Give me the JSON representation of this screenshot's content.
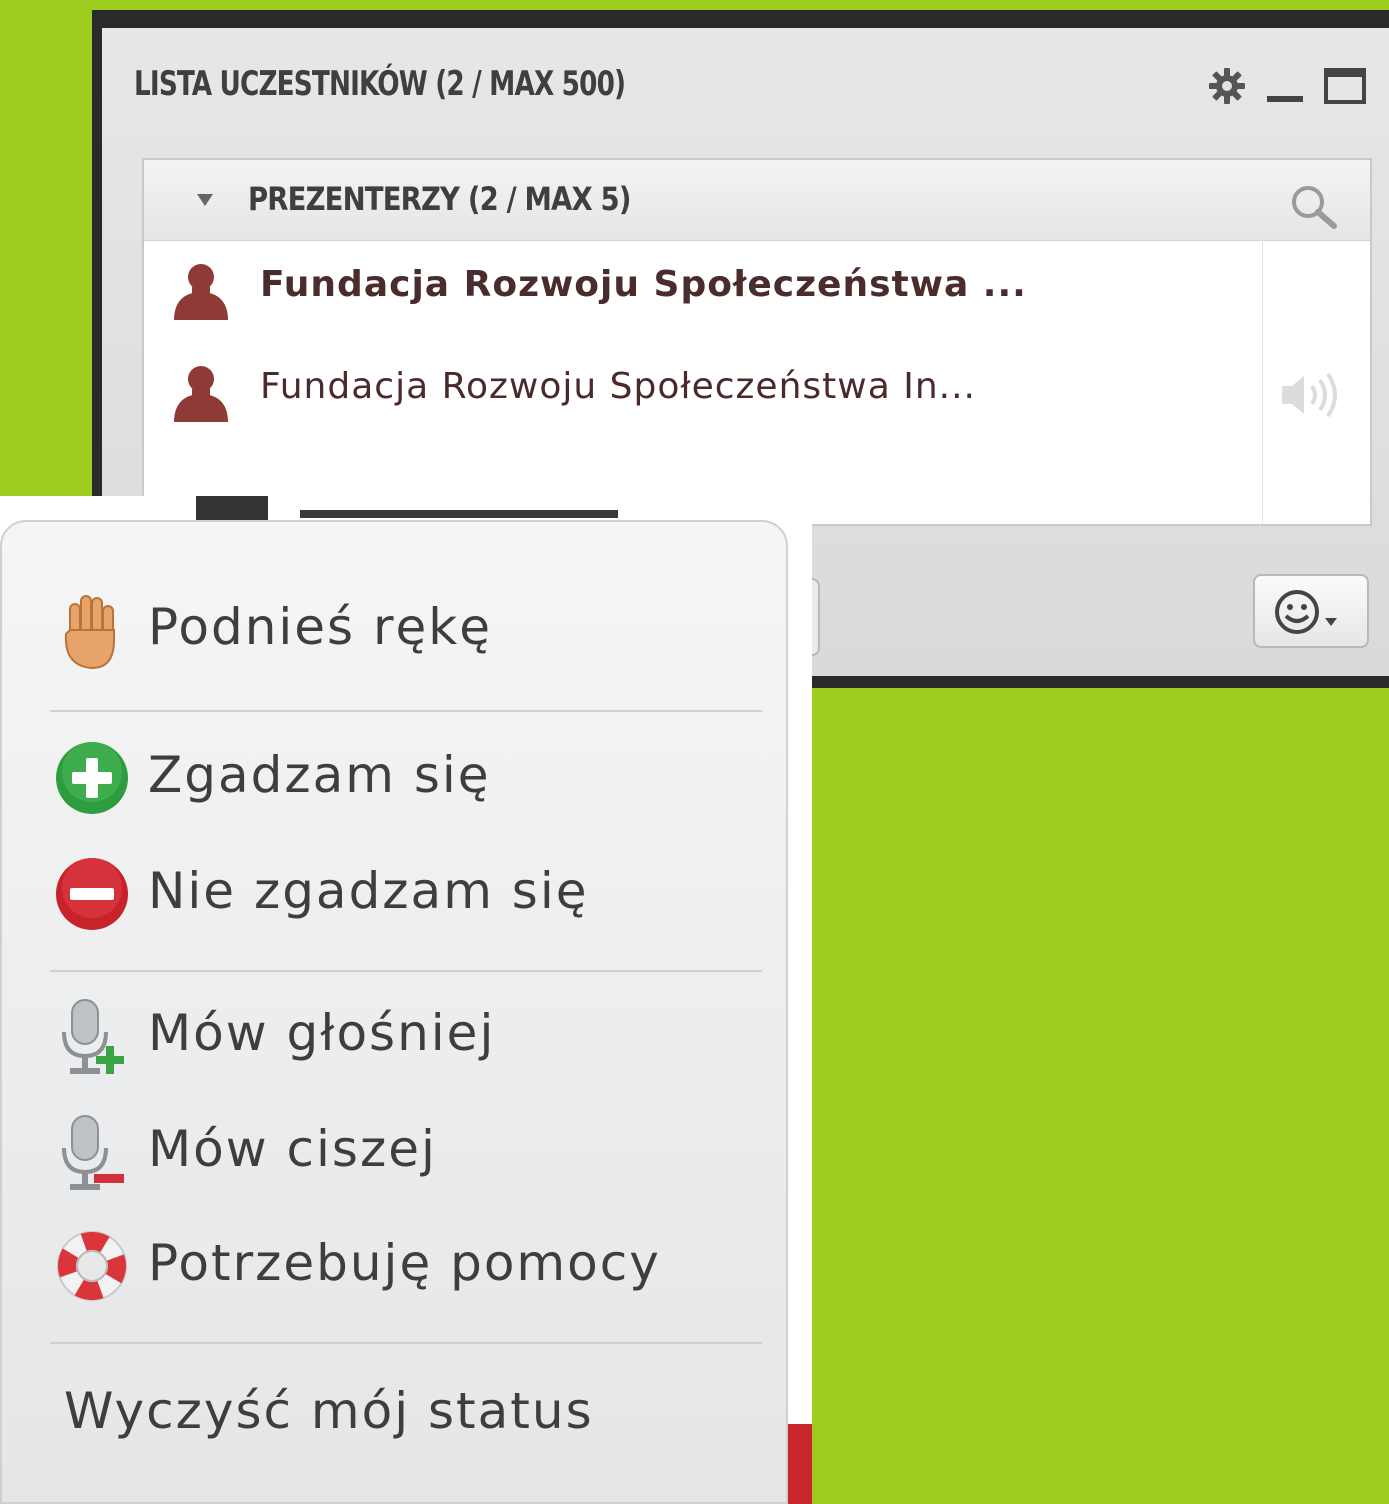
{
  "panel": {
    "title": "LISTA UCZESTNIKÓW  (2 / MAX 500)",
    "controls": [
      "settings-icon",
      "minimize-icon",
      "maximize-icon"
    ],
    "group": {
      "label": "PREZENTERZY (2 / MAX 5)",
      "expanded": true
    },
    "participants": [
      {
        "name": "Fundacja Rozwoju Społeczeństwa ...",
        "bold": true
      },
      {
        "name": "Fundacja Rozwoju Społeczeństwa In...",
        "bold": false,
        "audio": "speaker-icon"
      }
    ],
    "emoji_button": "smiley-dropdown-icon"
  },
  "menu": {
    "items": [
      {
        "label": "Podnieś rękę",
        "icon": "raise-hand-icon"
      },
      {
        "label": "Zgadzam się",
        "icon": "agree-plus-icon"
      },
      {
        "label": "Nie zgadzam się",
        "icon": "disagree-minus-icon"
      },
      {
        "label": "Mów głośniej",
        "icon": "mic-louder-icon"
      },
      {
        "label": "Mów ciszej",
        "icon": "mic-quieter-icon"
      },
      {
        "label": "Potrzebuję pomocy",
        "icon": "lifebuoy-icon"
      }
    ],
    "clear_label": "Wyczyść mój status"
  },
  "colors": {
    "background": "#9fcd1f",
    "avatar": "#8e3a36",
    "agree": "#2e9d3f",
    "disagree": "#c8222a"
  }
}
